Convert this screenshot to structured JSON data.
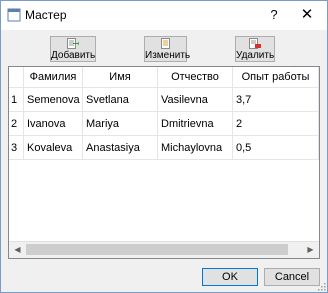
{
  "window": {
    "title": "Мастер",
    "help_glyph": "?",
    "close_glyph": "✕"
  },
  "toolbar": {
    "add_label": "Добавить",
    "edit_label": "Изменить",
    "delete_label": "Удалить"
  },
  "table": {
    "columns": [
      "Фамилия",
      "Имя",
      "Отчество",
      "Опыт работы"
    ],
    "rows": [
      {
        "num": "1",
        "cells": [
          "Semenova",
          "Svetlana",
          "Vasilevna",
          "3,7"
        ]
      },
      {
        "num": "2",
        "cells": [
          "Ivanova",
          "Mariya",
          "Dmitrievna",
          "2"
        ]
      },
      {
        "num": "3",
        "cells": [
          "Kovaleva",
          "Anastasiya",
          "Michaylovna",
          "0,5"
        ]
      }
    ]
  },
  "scrollbar": {
    "left_arrow": "◀",
    "right_arrow": "▶"
  },
  "buttons": {
    "ok_label": "OK",
    "cancel_label": "Cancel"
  },
  "colors": {
    "accent": "#0078d7",
    "add_icon": "#2ea043",
    "delete_icon": "#d9302c"
  }
}
